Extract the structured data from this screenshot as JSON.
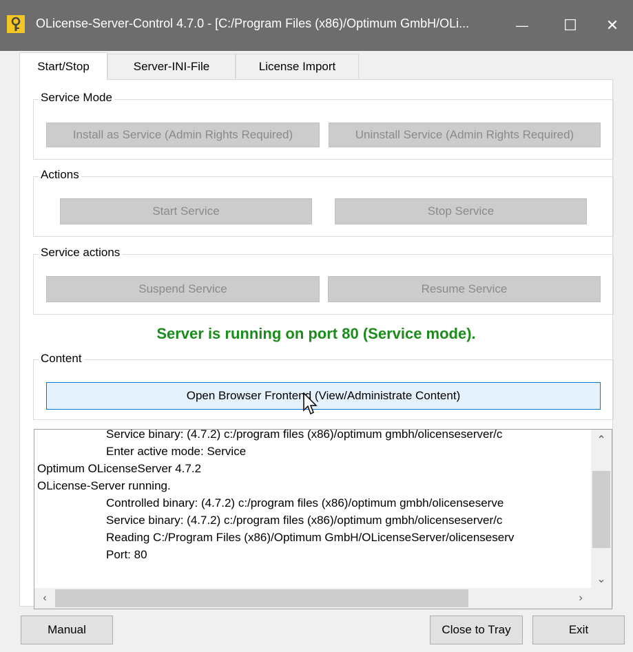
{
  "window": {
    "title": "OLicense-Server-Control 4.7.0 - [C:/Program Files (x86)/Optimum GmbH/OLi...",
    "minimize": "—",
    "maximize": "☐",
    "close": "✕"
  },
  "tabs": [
    {
      "label": "Start/Stop",
      "active": true
    },
    {
      "label": "Server-INI-File",
      "active": false
    },
    {
      "label": "License Import",
      "active": false
    }
  ],
  "service_mode": {
    "title": "Service Mode",
    "install_label": "Install as Service (Admin Rights Required)",
    "uninstall_label": "Uninstall Service (Admin Rights Required)"
  },
  "actions": {
    "title": "Actions",
    "start_label": "Start Service",
    "stop_label": "Stop Service"
  },
  "service_actions": {
    "title": "Service actions",
    "suspend_label": "Suspend Service",
    "resume_label": "Resume Service"
  },
  "status": {
    "text": "Server is running on port 80 (Service mode).",
    "color": "#1a8c1a"
  },
  "content": {
    "title": "Content",
    "open_label": "Open Browser Frontend (View/Administrate Content)"
  },
  "log": {
    "lines": [
      {
        "text": "Service binary: (4.7.2) c:/program files (x86)/optimum gmbh/olicenseserver/c",
        "indent": true
      },
      {
        "text": "Enter active mode: Service",
        "indent": true
      },
      {
        "text": "Optimum OLicenseServer 4.7.2",
        "indent": false
      },
      {
        "text": "OLicense-Server running.",
        "indent": false
      },
      {
        "text": "Controlled binary: (4.7.2) c:/program files (x86)/optimum gmbh/olicenseserve",
        "indent": true
      },
      {
        "text": "Service binary: (4.7.2) c:/program files (x86)/optimum gmbh/olicenseserver/c",
        "indent": true
      },
      {
        "text": "Reading C:/Program Files (x86)/Optimum GmbH/OLicenseServer/olicenseserv",
        "indent": true
      },
      {
        "text": "Port: 80",
        "indent": true
      }
    ]
  },
  "footer": {
    "manual_label": "Manual",
    "tray_label": "Close to Tray",
    "exit_label": "Exit"
  }
}
